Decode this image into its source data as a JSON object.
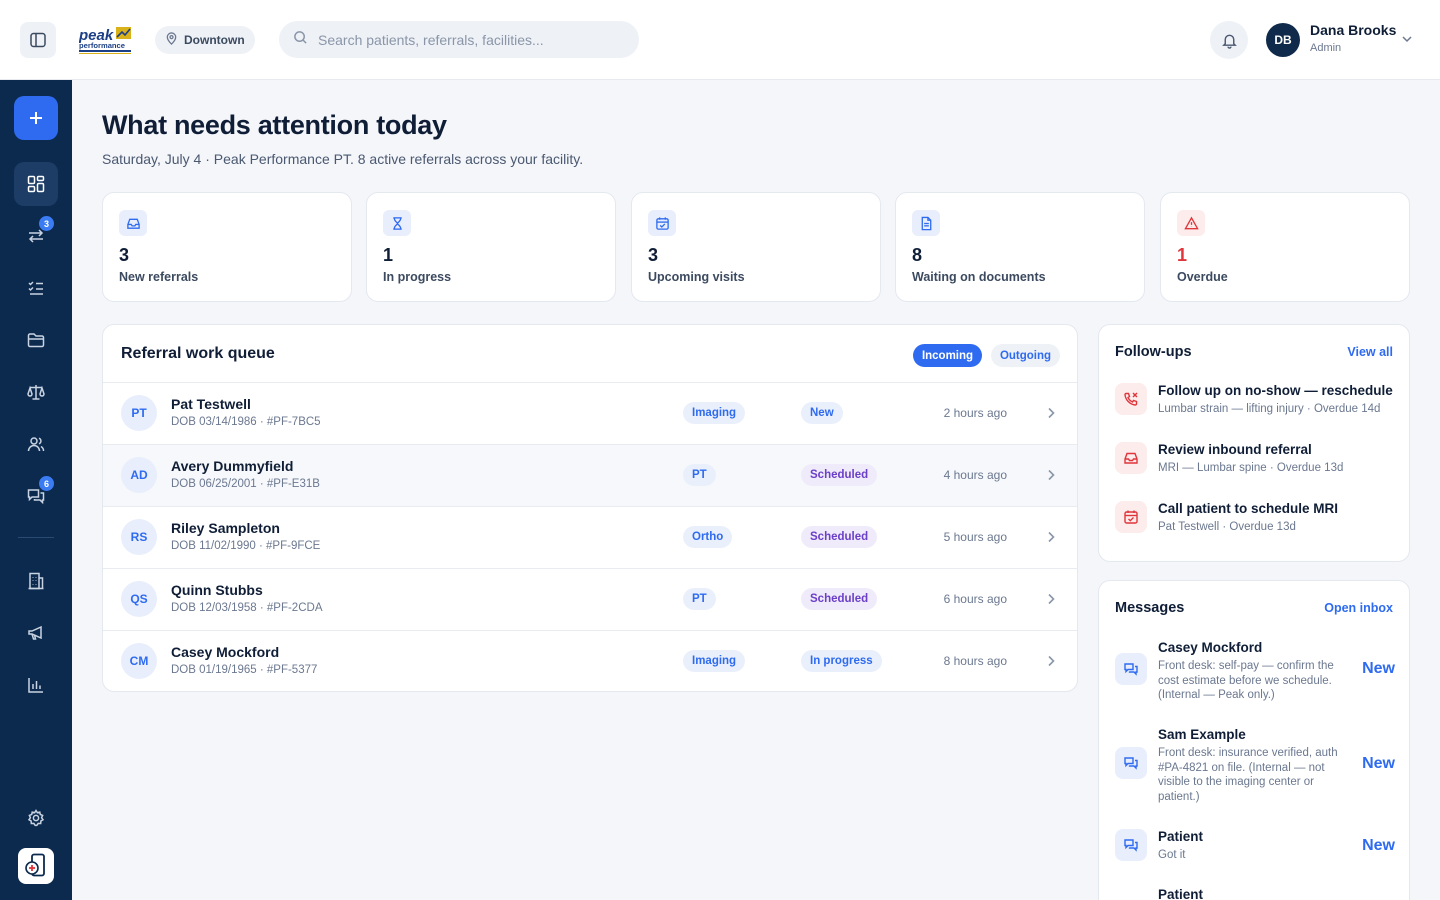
{
  "header": {
    "location": "Downtown",
    "search_placeholder": "Search patients, referrals, facilities...",
    "user": {
      "initials": "DB",
      "name": "Dana Brooks",
      "role": "Admin"
    }
  },
  "rail": {
    "badges": {
      "referrals": "3",
      "messages": "6"
    },
    "icons": [
      "plus-icon",
      "dashboard-icon",
      "referrals-icon",
      "tasks-icon",
      "folder-icon",
      "scales-icon",
      "users-icon",
      "messages-icon",
      "building-icon",
      "megaphone-icon",
      "chart-icon",
      "settings-icon"
    ]
  },
  "page": {
    "title": "What needs attention today",
    "subtitle": "Saturday, July 4 · Peak Performance PT. 8 active referrals across your facility."
  },
  "stats": [
    {
      "value": "3",
      "label": "New referrals",
      "icon": "inbox-icon"
    },
    {
      "value": "1",
      "label": "In progress",
      "icon": "hourglass-icon"
    },
    {
      "value": "3",
      "label": "Upcoming visits",
      "icon": "calendar-check-icon"
    },
    {
      "value": "8",
      "label": "Waiting on documents",
      "icon": "document-icon"
    },
    {
      "value": "1",
      "label": "Overdue",
      "icon": "alert-icon",
      "accent": "#e0353b"
    }
  ],
  "queue": {
    "title": "Referral work queue",
    "tabs": {
      "incoming": "Incoming",
      "outgoing": "Outgoing"
    },
    "rows": [
      {
        "initials": "PT",
        "name": "Pat Testwell",
        "meta": "DOB 03/14/1986 · #PF-7BC5",
        "type": "Imaging",
        "status": "New",
        "time": "2 hours ago"
      },
      {
        "initials": "AD",
        "name": "Avery Dummyfield",
        "meta": "DOB 06/25/2001 · #PF-E31B",
        "type": "PT",
        "status": "Scheduled",
        "time": "4 hours ago"
      },
      {
        "initials": "RS",
        "name": "Riley Sampleton",
        "meta": "DOB 11/02/1990 · #PF-9FCE",
        "type": "Ortho",
        "status": "Scheduled",
        "time": "5 hours ago"
      },
      {
        "initials": "QS",
        "name": "Quinn Stubbs",
        "meta": "DOB 12/03/1958 · #PF-2CDA",
        "type": "PT",
        "status": "Scheduled",
        "time": "6 hours ago"
      },
      {
        "initials": "CM",
        "name": "Casey Mockford",
        "meta": "DOB 01/19/1965 · #PF-5377",
        "type": "Imaging",
        "status": "In progress",
        "time": "8 hours ago"
      }
    ]
  },
  "followups": {
    "title": "Follow-ups",
    "link": "View all",
    "items": [
      {
        "title": "Follow up on no-show — reschedule",
        "sub": "Lumbar strain — lifting injury · Overdue 14d",
        "icon": "phone-missed-icon"
      },
      {
        "title": "Review inbound referral",
        "sub": "MRI — Lumbar spine · Overdue 13d",
        "icon": "inbox-icon"
      },
      {
        "title": "Call patient to schedule MRI",
        "sub": "Pat Testwell · Overdue 13d",
        "icon": "calendar-check-icon"
      }
    ]
  },
  "messages": {
    "title": "Messages",
    "link": "Open inbox",
    "items": [
      {
        "name": "Casey Mockford",
        "text": "Front desk: self-pay — confirm the cost estimate before we schedule. (Internal — Peak only.)",
        "badge": "New"
      },
      {
        "name": "Sam Example",
        "text": "Front desk: insurance verified, auth #PA-4821 on file. (Internal — not visible to the imaging center or patient.)",
        "badge": "New"
      },
      {
        "name": "Patient",
        "text": "Got it",
        "badge": "New"
      },
      {
        "name": "Patient",
        "text": "",
        "badge": ""
      }
    ]
  },
  "colors": {
    "accent": "#2f6bf0",
    "rail": "#0c2a4e",
    "danger": "#e0353b",
    "scheduled": "#6b3fc7"
  }
}
